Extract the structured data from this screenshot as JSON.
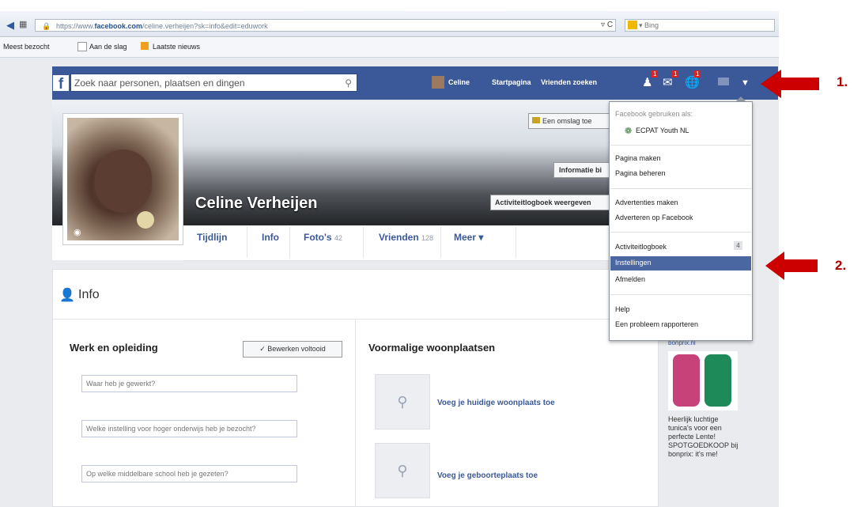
{
  "browser": {
    "url_prefix": "https://www.",
    "url_domain": "facebook.com",
    "url_rest": "/celine.verheijen?sk=info&edit=eduwork",
    "refresh": "C",
    "search_engine": "Bing"
  },
  "bookmarks": [
    "Meest bezocht",
    "Aan de slag",
    "Laatste nieuws"
  ],
  "fb": {
    "logo": "f",
    "search_placeholder": "Zoek naar personen, plaatsen en dingen",
    "user_name": "Celine",
    "nav": [
      "Startpagina",
      "Vrienden zoeken"
    ],
    "badges": [
      "1",
      "1",
      "1"
    ]
  },
  "cover": {
    "button_cover": "Een omslag toe",
    "button_info": "Informatie bi",
    "button_activity": "Activiteitlogboek weergeven",
    "profile_name": "Celine Verheijen"
  },
  "tabs": [
    {
      "label": "Tijdlijn",
      "count": ""
    },
    {
      "label": "Info",
      "count": ""
    },
    {
      "label": "Foto's",
      "count": "42"
    },
    {
      "label": "Vrienden",
      "count": "128"
    },
    {
      "label": "Meer ▾",
      "count": ""
    }
  ],
  "info": {
    "title": "Info",
    "work_title": "Werk en opleiding",
    "edit_done": "Bewerken voltooid",
    "fields": [
      "Waar heb je gewerkt?",
      "Welke instelling voor hoger onderwijs heb je bezocht?",
      "Op welke middelbare school heb je gezeten?"
    ],
    "places_title": "Voormalige woonplaatsen",
    "places": [
      "Voeg je huidige woonplaats toe",
      "Voeg je geboorteplaats toe"
    ]
  },
  "menu": {
    "header": "Facebook gebruiken als:",
    "page": "ECPAT Youth NL",
    "group1": [
      "Pagina maken",
      "Pagina beheren"
    ],
    "group2": [
      "Advertenties maken",
      "Adverteren op Facebook"
    ],
    "group3": [
      "Activiteitlogboek",
      "Instellingen",
      "Afmelden"
    ],
    "activity_badge": "4",
    "group4": [
      "Help",
      "Een probleem rapporteren"
    ]
  },
  "ad": {
    "label": "bonprix.nl",
    "text": "Heerlijk luchtige tunica's voor een perfecte Lente! SPOTGOEDKOOP bij bonprix: it's me!"
  },
  "annotations": [
    "1.",
    "2."
  ],
  "colors": {
    "fb_blue": "#3b5998",
    "arrow_red": "#cc0000",
    "highlight": "#4b67a1"
  }
}
